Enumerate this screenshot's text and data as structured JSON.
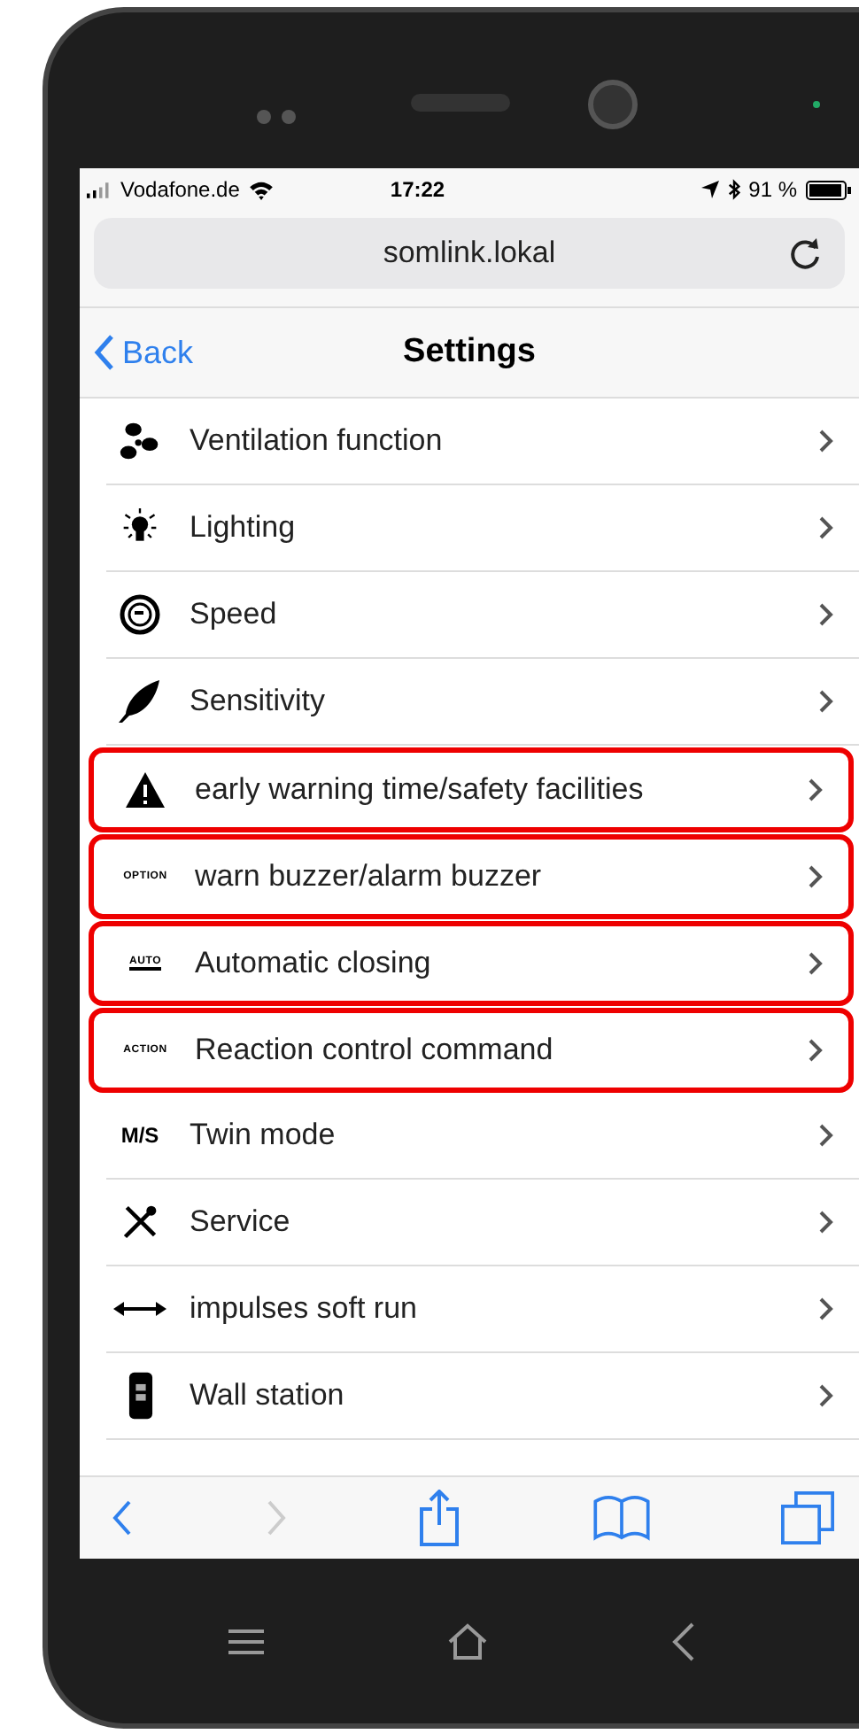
{
  "status_bar": {
    "carrier": "Vodafone.de",
    "time": "17:22",
    "battery": "91 %"
  },
  "address_bar": {
    "url": "somlink.lokal"
  },
  "nav_bar": {
    "back": "Back",
    "title": "Settings"
  },
  "items": [
    {
      "label": "Ventilation function",
      "highlighted": false
    },
    {
      "label": "Lighting",
      "highlighted": false
    },
    {
      "label": "Speed",
      "highlighted": false
    },
    {
      "label": "Sensitivity",
      "highlighted": false
    },
    {
      "label": "early warning time/safety facilities",
      "highlighted": true
    },
    {
      "label": "warn buzzer/alarm buzzer",
      "icon_text": "OPTION",
      "highlighted": true
    },
    {
      "label": "Automatic closing",
      "icon_text": "AUTO",
      "highlighted": true
    },
    {
      "label": "Reaction control command",
      "icon_text": "ACTION",
      "highlighted": true
    },
    {
      "label": "Twin mode",
      "icon_text": "M/S",
      "highlighted": false
    },
    {
      "label": "Service",
      "highlighted": false
    },
    {
      "label": "impulses soft run",
      "highlighted": false
    },
    {
      "label": "Wall station",
      "highlighted": false
    }
  ]
}
